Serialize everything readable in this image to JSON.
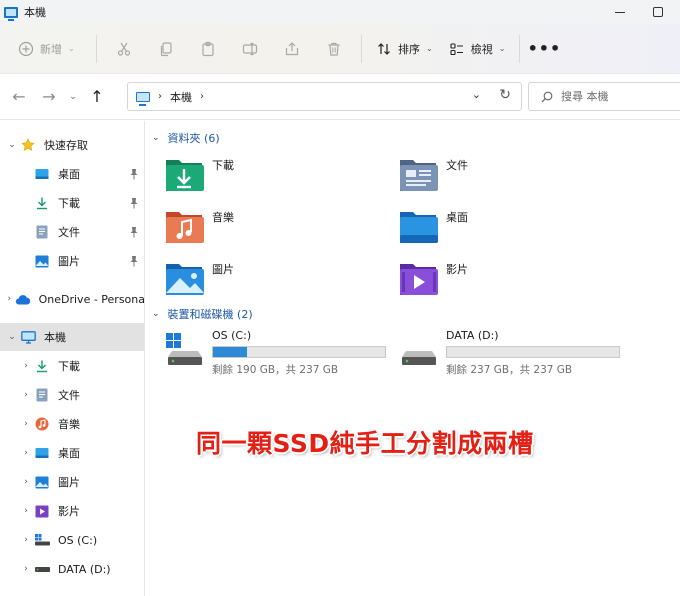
{
  "window": {
    "title": "本機"
  },
  "toolbar": {
    "new_label": "新增",
    "sort_label": "排序",
    "view_label": "檢視",
    "more_label": "•••"
  },
  "address": {
    "breadcrumb": "本機",
    "search_placeholder": "搜尋 本機"
  },
  "sidebar": {
    "quick_access": {
      "label": "快速存取",
      "items": [
        {
          "label": "桌面",
          "icon": "desktop-icon",
          "pinned": true
        },
        {
          "label": "下載",
          "icon": "download-icon",
          "pinned": true
        },
        {
          "label": "文件",
          "icon": "document-icon",
          "pinned": true
        },
        {
          "label": "圖片",
          "icon": "picture-icon",
          "pinned": true
        }
      ]
    },
    "onedrive": {
      "label": "OneDrive - Persona"
    },
    "this_pc": {
      "label": "本機",
      "items": [
        {
          "label": "下載",
          "icon": "download-icon"
        },
        {
          "label": "文件",
          "icon": "document-icon"
        },
        {
          "label": "音樂",
          "icon": "music-icon"
        },
        {
          "label": "桌面",
          "icon": "desktop-icon"
        },
        {
          "label": "圖片",
          "icon": "picture-icon"
        },
        {
          "label": "影片",
          "icon": "video-icon"
        },
        {
          "label": "OS (C:)",
          "icon": "windows-drive-icon"
        },
        {
          "label": "DATA (D:)",
          "icon": "drive-icon"
        }
      ]
    }
  },
  "main": {
    "folders_header": "資料夾 (6)",
    "folders": [
      {
        "name": "下載",
        "icon": "downloads-folder-icon"
      },
      {
        "name": "文件",
        "icon": "documents-folder-icon"
      },
      {
        "name": "音樂",
        "icon": "music-folder-icon"
      },
      {
        "name": "桌面",
        "icon": "desktop-folder-icon"
      },
      {
        "name": "圖片",
        "icon": "pictures-folder-icon"
      },
      {
        "name": "影片",
        "icon": "videos-folder-icon"
      }
    ],
    "drives_header": "裝置和磁碟機 (2)",
    "drives": [
      {
        "name": "OS (C:)",
        "free_text": "剩餘 190 GB，共 237 GB",
        "used_fraction": 0.198,
        "bar_color": "#2d8bd6"
      },
      {
        "name": "DATA (D:)",
        "free_text": "剩餘 237 GB，共 237 GB",
        "used_fraction": 0.0,
        "bar_color": "#2d8bd6"
      }
    ]
  },
  "caption": "同一顆SSD純手工分割成兩槽"
}
